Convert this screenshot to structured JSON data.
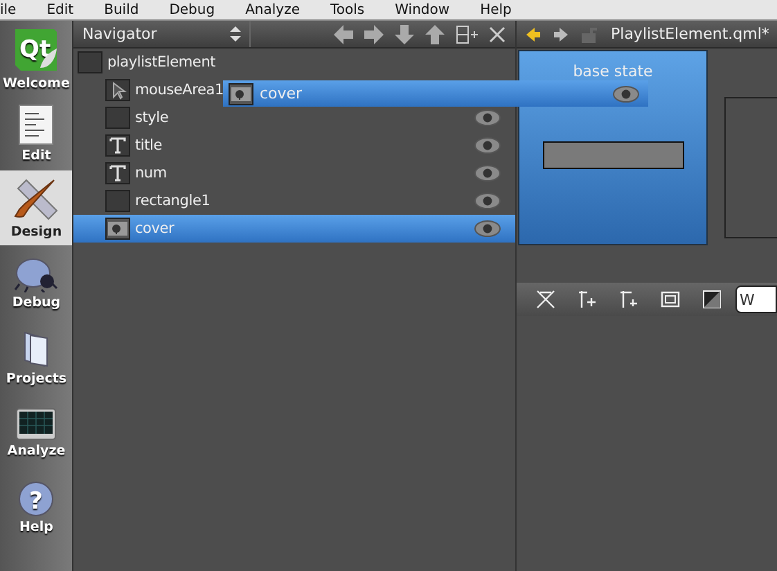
{
  "menu": [
    "ile",
    "Edit",
    "Build",
    "Debug",
    "Analyze",
    "Tools",
    "Window",
    "Help"
  ],
  "modes": [
    {
      "label": "Welcome",
      "kind": "qt",
      "logo": "Qt",
      "selected": false
    },
    {
      "label": "Edit",
      "kind": "edit",
      "selected": false
    },
    {
      "label": "Design",
      "kind": "design",
      "selected": true
    },
    {
      "label": "Debug",
      "kind": "debug",
      "selected": false
    },
    {
      "label": "Projects",
      "kind": "projects",
      "selected": false
    },
    {
      "label": "Analyze",
      "kind": "analyze",
      "selected": false
    },
    {
      "label": "Help",
      "kind": "help",
      "logo": "?",
      "selected": false
    }
  ],
  "navigator": {
    "title": "Navigator",
    "tree": [
      {
        "name": "playlistElement",
        "kind": "rect",
        "selected": false,
        "children": [
          {
            "name": "mouseArea1",
            "kind": "mouse",
            "selected": false
          },
          {
            "name": "style",
            "kind": "item",
            "selected": false
          },
          {
            "name": "title",
            "kind": "text",
            "selected": false
          },
          {
            "name": "num",
            "kind": "text",
            "selected": false
          },
          {
            "name": "rectangle1",
            "kind": "rect",
            "selected": false
          },
          {
            "name": "cover",
            "kind": "image",
            "selected": true
          }
        ]
      }
    ],
    "drag_item": {
      "name": "cover",
      "kind": "image"
    }
  },
  "editor": {
    "file": "PlaylistElement.qml*"
  },
  "states": [
    {
      "label": "base state",
      "selected": true
    }
  ],
  "form_field": {
    "value": "W"
  }
}
